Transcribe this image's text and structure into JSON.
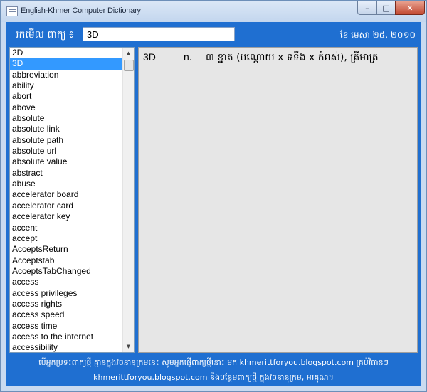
{
  "window": {
    "title": "English-Khmer Computer Dictionary",
    "minimize": "–",
    "maximize": "□",
    "close": "✕"
  },
  "search": {
    "label": "រកមើល ពាក្យ ៖",
    "value": "3D"
  },
  "date": "ខែ មេសា ២៥, ២០១០",
  "word_list": {
    "selected_index": 1,
    "items": [
      "2D",
      "3D",
      "abbreviation",
      "ability",
      "abort",
      "above",
      "absolute",
      "absolute link",
      "absolute path",
      "absolute url",
      "absolute value",
      "abstract",
      "abuse",
      "accelerator board",
      "accelerator card",
      "accelerator key",
      "accent",
      "accept",
      "AcceptsReturn",
      "Acceptstab",
      "AcceptsTabChanged",
      "access",
      "access privileges",
      "access rights",
      "access speed",
      "access time",
      "access to the internet",
      "accessibility"
    ],
    "scroll_up_icon": "▲",
    "scroll_down_icon": "▼"
  },
  "entry": {
    "word": "3D",
    "part_of_speech": "n.",
    "definition": "៣ ខ្នាត (បណ្ដោយ x ទទឹង x កំពស់),   ត្រីមាត្រ"
  },
  "footer": {
    "line1": "បើអ្នកប្រទះពាក្យថ្មី គ្មានក្នុងវចនានុក្រមនេះ សូមអ្នកផ្ញើពាក្យថ្មីនោះ មក khmerittforyou.blogspot.com គ្រប់វិធានៗ",
    "line2": "khmerittforyou.blogspot.com នឹងបន្ថែមពាក្យថ្មី ក្នុងវចនានុក្រម, អរគុណ។"
  },
  "colors": {
    "client_background": "#1f6fd1",
    "selection": "#3399ff",
    "detail_background": "#e6e6e6"
  }
}
